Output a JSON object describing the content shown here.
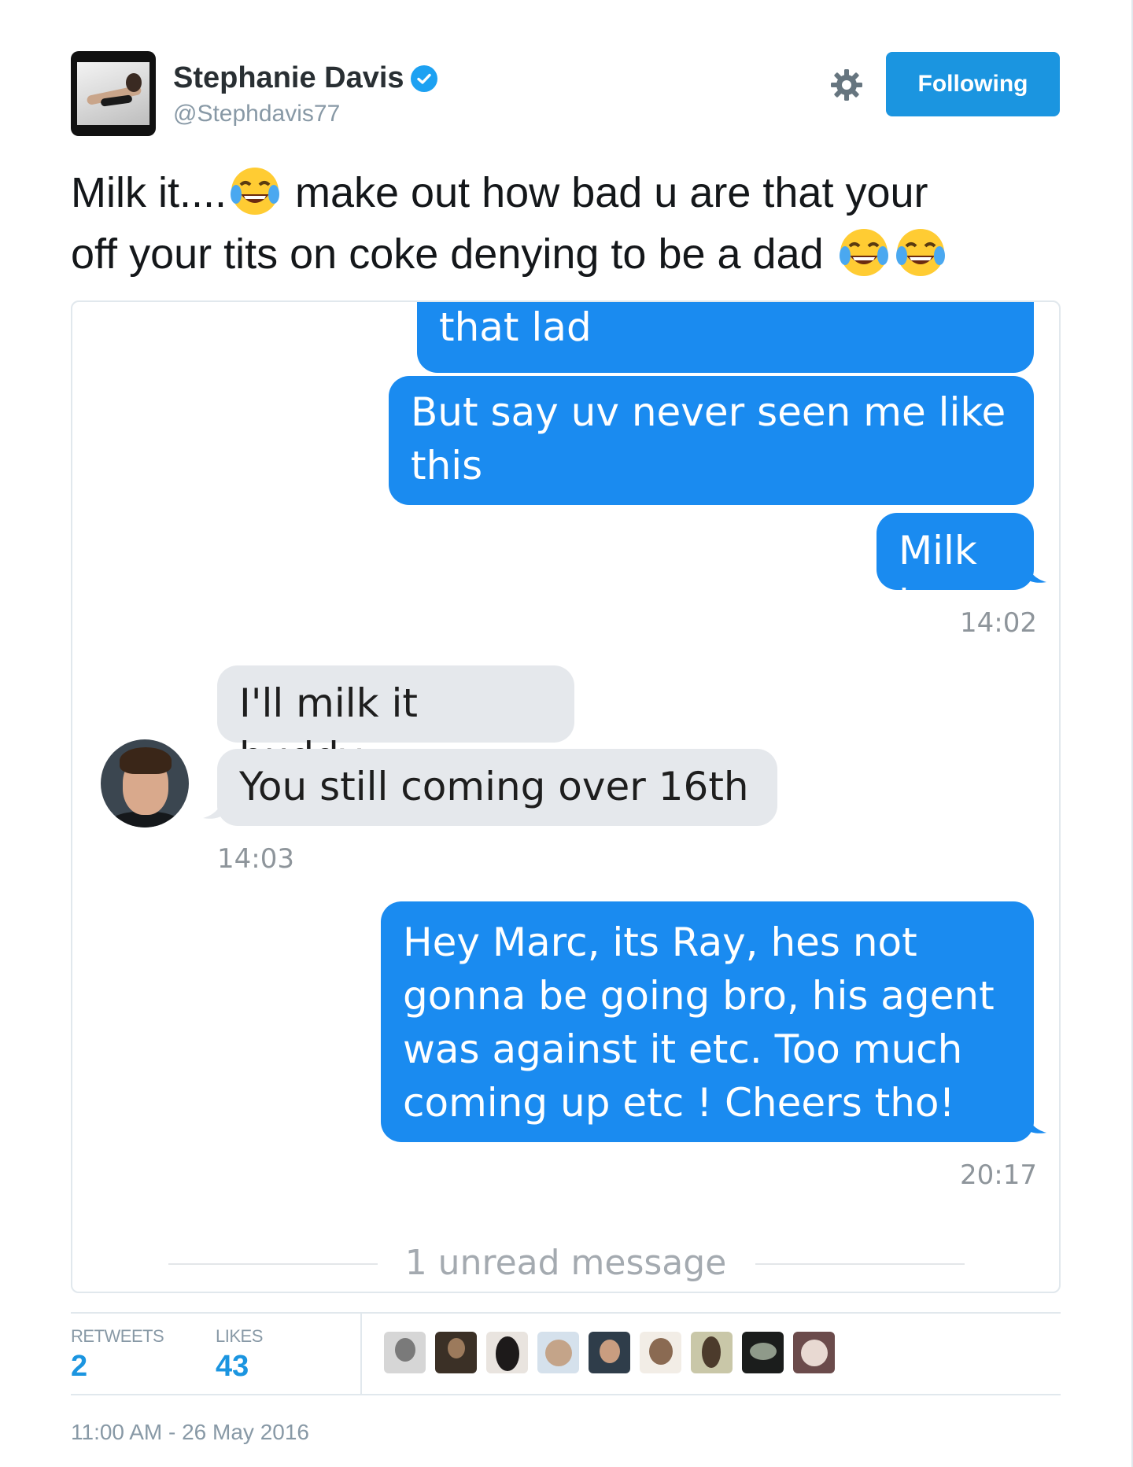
{
  "tweet": {
    "display_name": "Stephanie Davis",
    "handle": "@Stephdavis77",
    "follow_label": "Following",
    "text_line1_a": "Milk it....",
    "text_line1_b": " make out how bad u are that your",
    "text_line2": "off your tits on coke denying to be a dad ",
    "emoji_name": "face-with-tears-of-joy-icon",
    "timestamp": "11:00 AM - 26 May 2016"
  },
  "conversation": {
    "messages": [
      {
        "direction": "outgoing",
        "text": "that lad"
      },
      {
        "direction": "outgoing",
        "line1": "But say uv never seen me like",
        "line2": "this"
      },
      {
        "direction": "outgoing",
        "text": "Milk it",
        "time": "14:02"
      },
      {
        "direction": "incoming",
        "text": "I'll milk it buddy"
      },
      {
        "direction": "incoming",
        "text": "You still coming over 16th",
        "time": "14:03"
      },
      {
        "direction": "outgoing",
        "line1": "Hey Marc, its Ray,  hes not",
        "line2": "gonna be going bro, his agent",
        "line3": "was against it etc. Too much",
        "line4": "coming up etc ! Cheers tho!",
        "time": "20:17"
      }
    ],
    "unread": "1 unread message"
  },
  "stats": {
    "retweets_label": "RETWEETS",
    "retweets_value": "2",
    "likes_label": "LIKES",
    "likes_value": "43"
  },
  "colors": {
    "brand": "#1b95e0",
    "outgoing_bubble": "#1a8bf0",
    "incoming_bubble": "#e5e8ec"
  }
}
